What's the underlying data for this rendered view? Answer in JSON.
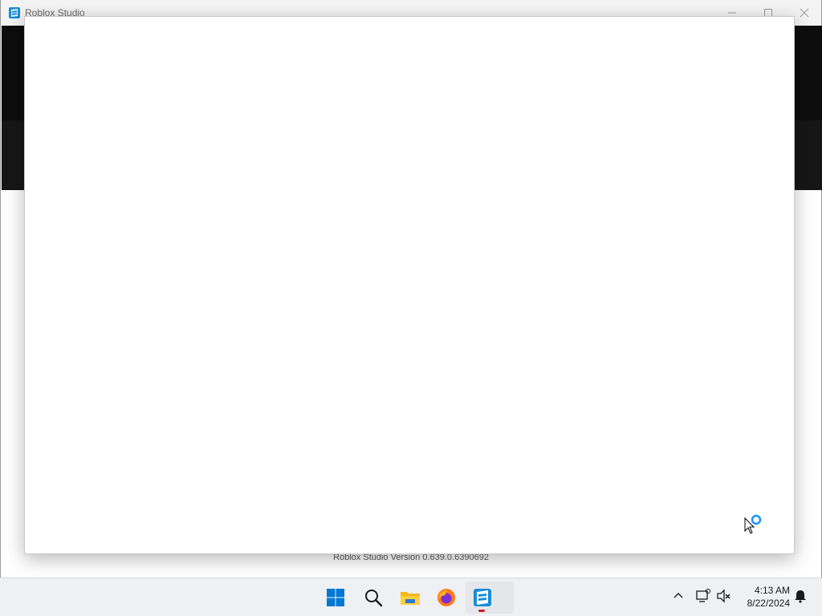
{
  "window": {
    "title": "Roblox Studio",
    "controls": {
      "minimize_icon": "minimize-icon",
      "maximize_icon": "maximize-icon",
      "close_icon": "close-icon"
    }
  },
  "splash": {
    "version_text": "Roblox Studio Version 0.639.0.6390692"
  },
  "taskbar": {
    "apps": [
      {
        "name": "Start",
        "icon": "windows-start-icon"
      },
      {
        "name": "Search",
        "icon": "search-icon"
      },
      {
        "name": "File Explorer",
        "icon": "folder-icon"
      },
      {
        "name": "Firefox",
        "icon": "firefox-icon"
      },
      {
        "name": "Roblox Studio",
        "icon": "roblox-studio-icon",
        "active": true
      }
    ],
    "tray": {
      "chevron_icon": "chevron-up-icon",
      "network_icon": "network-icon",
      "volume_icon": "volume-muted-icon",
      "notification_icon": "bell-icon"
    },
    "clock": {
      "time": "4:13 AM",
      "date": "8/22/2024"
    }
  },
  "colors": {
    "roblox_blue": "#1a8cd8",
    "windows_blue": "#0078d4",
    "active_indicator": "#d21c1c",
    "taskbar_bg": "#eef0f3"
  }
}
